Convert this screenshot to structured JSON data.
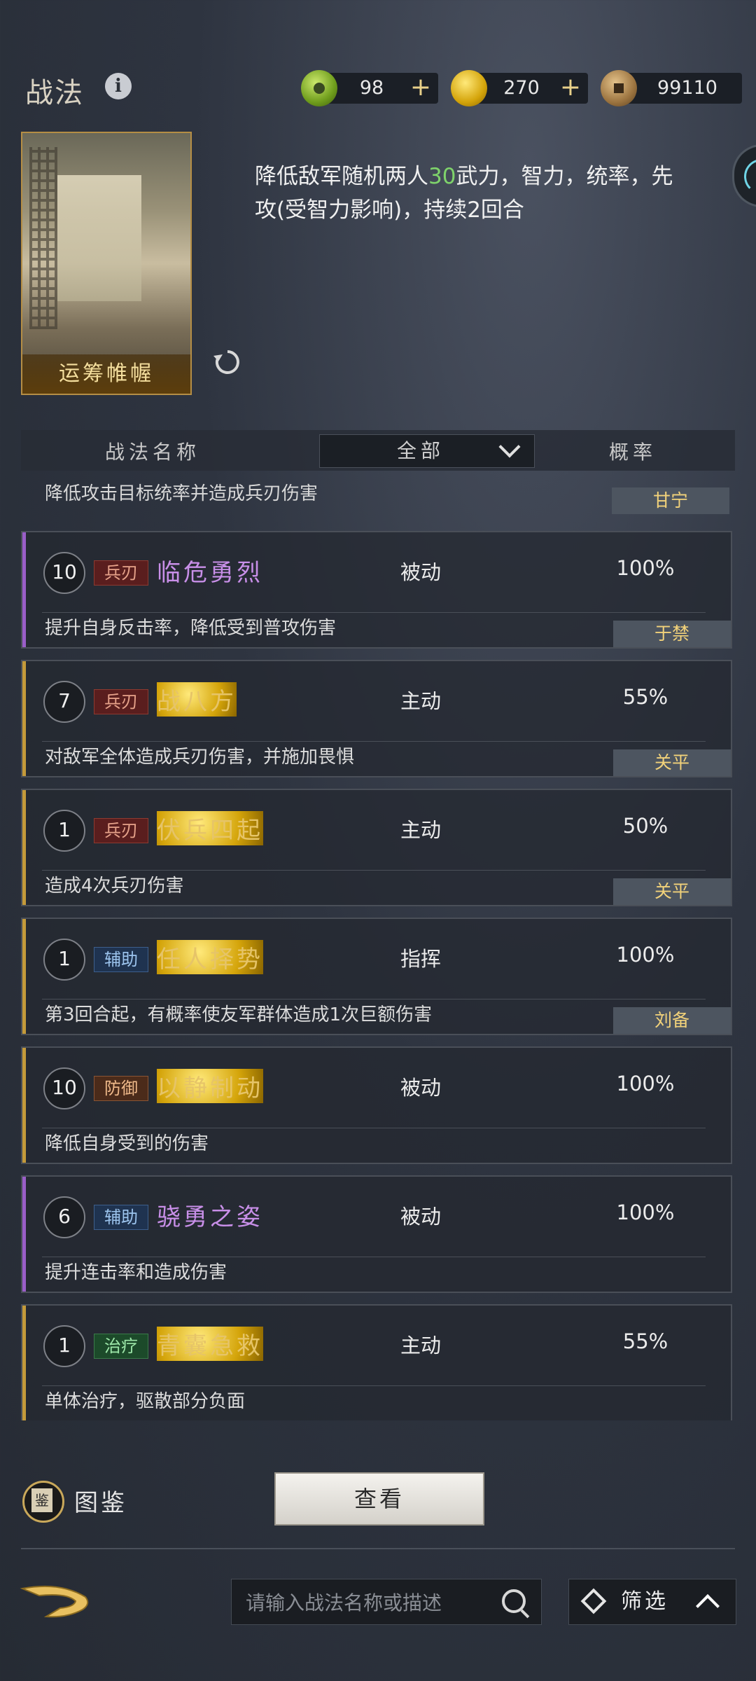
{
  "header": {
    "title": "战法"
  },
  "resources": [
    {
      "icon": "jade-icon",
      "value": "98",
      "plus": "+"
    },
    {
      "icon": "gold-coin-icon",
      "value": "270",
      "plus": "+"
    },
    {
      "icon": "copper-coin-icon",
      "value": "99110"
    }
  ],
  "selected": {
    "card_name": "运筹帷幄",
    "desc_pre": "降低敌军随机两人",
    "desc_hl": "30",
    "desc_post": "武力，智力，统率，先攻(受智力影响)，持续2回合"
  },
  "list_header": {
    "name": "战法名称",
    "filter": "全部",
    "rate": "概率"
  },
  "partial_item": {
    "desc": "降低攻击目标统率并造成兵刃伤害",
    "general": "甘宁"
  },
  "items": [
    {
      "level": "10",
      "tag": "兵刃",
      "name": "临危勇烈",
      "type": "被动",
      "rate": "100%",
      "desc": "提升自身反击率，降低受到普攻伤害",
      "general": "于禁"
    },
    {
      "level": "7",
      "tag": "兵刃",
      "name": "战八方",
      "type": "主动",
      "rate": "55%",
      "desc": "对敌军全体造成兵刃伤害，并施加畏惧",
      "general": "关平"
    },
    {
      "level": "1",
      "tag": "兵刃",
      "name": "伏兵四起",
      "type": "主动",
      "rate": "50%",
      "desc": "造成4次兵刃伤害",
      "general": "关平"
    },
    {
      "level": "1",
      "tag": "辅助",
      "name": "任人择势",
      "type": "指挥",
      "rate": "100%",
      "desc": "第3回合起，有概率使友军群体造成1次巨额伤害",
      "general": "刘备"
    },
    {
      "level": "10",
      "tag": "防御",
      "name": "以静制动",
      "type": "被动",
      "rate": "100%",
      "desc": "降低自身受到的伤害"
    },
    {
      "level": "6",
      "tag": "辅助",
      "name": "骁勇之姿",
      "type": "被动",
      "rate": "100%",
      "desc": "提升连击率和造成伤害"
    },
    {
      "level": "1",
      "tag": "治疗",
      "name": "青囊急救",
      "type": "主动",
      "rate": "55%",
      "desc": "单体治疗，驱散部分负面"
    }
  ],
  "bottom": {
    "atlas": "图鉴",
    "view": "查看",
    "search_placeholder": "请输入战法名称或描述",
    "filter": "筛选"
  },
  "colors": {
    "highlight": "#7fd36b",
    "purple": "#c88fe8",
    "gold": "#e6c468"
  }
}
